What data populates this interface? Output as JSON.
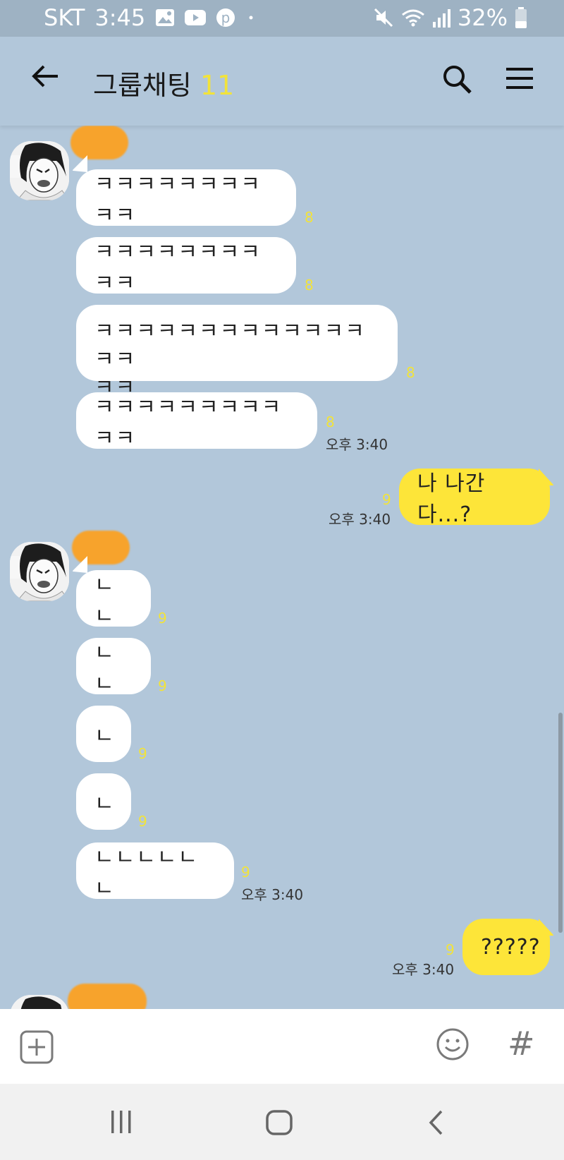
{
  "status_bar": {
    "carrier": "SKT",
    "time": "3:45",
    "battery": "32%",
    "icons_left": [
      "gallery-icon",
      "youtube-icon",
      "pinterest-icon",
      "dot-icon"
    ],
    "icons_right": [
      "mute-icon",
      "wifi-icon",
      "signal-icon",
      "battery-icon"
    ]
  },
  "header": {
    "title": "그룹채팅",
    "member_count": "11"
  },
  "messages": [
    {
      "sender": "other",
      "text": "ㅋㅋㅋㅋㅋㅋㅋㅋㅋㅋ",
      "unread": "8"
    },
    {
      "sender": "other",
      "text": "ㅋㅋㅋㅋㅋㅋㅋㅋㅋㅋ",
      "unread": "8"
    },
    {
      "sender": "other",
      "text_line1": "ㅋㅋㅋㅋㅋㅋㅋㅋㅋㅋㅋㅋㅋㅋㅋ",
      "text_line2": "ㅋㅋ",
      "unread": "8"
    },
    {
      "sender": "other",
      "text": "ㅋㅋㅋㅋㅋㅋㅋㅋㅋㅋㅋ",
      "unread": "8",
      "time": "오후 3:40"
    },
    {
      "sender": "me",
      "text": "나 나간다...?",
      "unread": "9",
      "time": "오후 3:40"
    },
    {
      "sender": "other",
      "text": "ㄴㄴ",
      "unread": "9"
    },
    {
      "sender": "other",
      "text": "ㄴㄴ",
      "unread": "9"
    },
    {
      "sender": "other",
      "text": "ㄴ",
      "unread": "9"
    },
    {
      "sender": "other",
      "text": "ㄴ",
      "unread": "9"
    },
    {
      "sender": "other",
      "text": "ㄴㄴㄴㄴㄴㄴ",
      "unread": "9",
      "time": "오후 3:40"
    },
    {
      "sender": "me",
      "text": "?????",
      "unread": "9",
      "time": "오후 3:40"
    }
  ],
  "colors": {
    "chat_bg": "#b2c7da",
    "my_bubble": "#fde539",
    "other_bubble": "#ffffff",
    "unread_count": "#f2e33a",
    "name_redaction": "#f7a32c"
  },
  "input_bar": {
    "hash_symbol": "#"
  }
}
